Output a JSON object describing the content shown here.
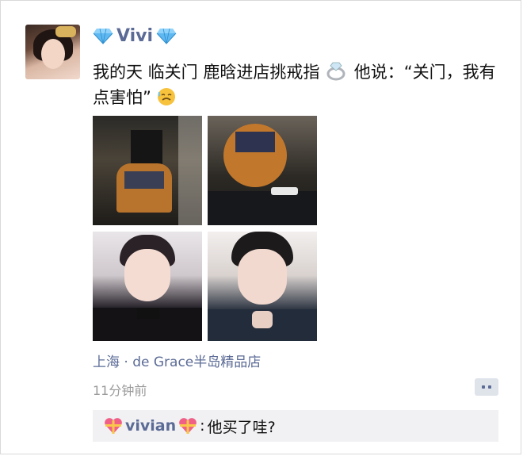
{
  "post": {
    "username": "Vivi",
    "username_icon": "diamond-icon",
    "text_part1": "我的天 临关门 鹿晗进店挑戒指",
    "ring_icon": "ring-icon",
    "text_part2": " 他说：“关门，我有点害怕”",
    "emoji_icon": "cold-sweat-emoji-icon",
    "location": "上海 · de Grace半岛精品店",
    "time": "11分钟前"
  },
  "comments": [
    {
      "commenter": "vivian",
      "commenter_icon": "heart-gift-icon",
      "separator": ":",
      "text": "他买了哇?"
    }
  ],
  "colors": {
    "link_blue": "#5b6b96",
    "meta_gray": "#9a9a9a",
    "comment_bg": "#f1f1f3"
  }
}
